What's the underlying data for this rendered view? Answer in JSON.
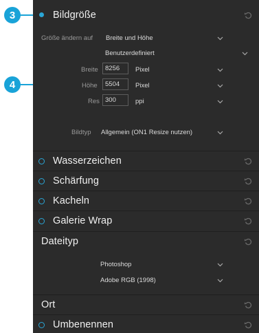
{
  "callouts": {
    "three": "3",
    "four": "4"
  },
  "colors": {
    "accent": "#19a3d8",
    "panel_bg": "#2b2b2b",
    "label_gray": "#9a9a9a"
  },
  "bildgroesse": {
    "title": "Bildgröße",
    "resize_label": "Größe ändern auf",
    "resize_value": "Breite und Höhe",
    "preset_value": "Benutzerdefiniert",
    "width_label": "Breite",
    "width_value": "8256",
    "width_unit": "Pixel",
    "height_label": "Höhe",
    "height_value": "5504",
    "height_unit": "Pixel",
    "res_label": "Res",
    "res_value": "300",
    "res_unit": "ppi",
    "type_label": "Bildtyp",
    "type_value": "Allgemein (ON1 Resize nutzen)"
  },
  "sections": {
    "wasserzeichen": "Wasserzeichen",
    "schaerfung": "Schärfung",
    "kacheln": "Kacheln",
    "galerie_wrap": "Galerie Wrap",
    "dateityp": "Dateityp",
    "ort": "Ort",
    "umbenennen": "Umbenennen"
  },
  "dateityp": {
    "format_value": "Photoshop",
    "colorspace_value": "Adobe RGB (1998)"
  },
  "icons": {
    "reset": "reset-icon",
    "dropdown": "chevron-down-icon"
  }
}
